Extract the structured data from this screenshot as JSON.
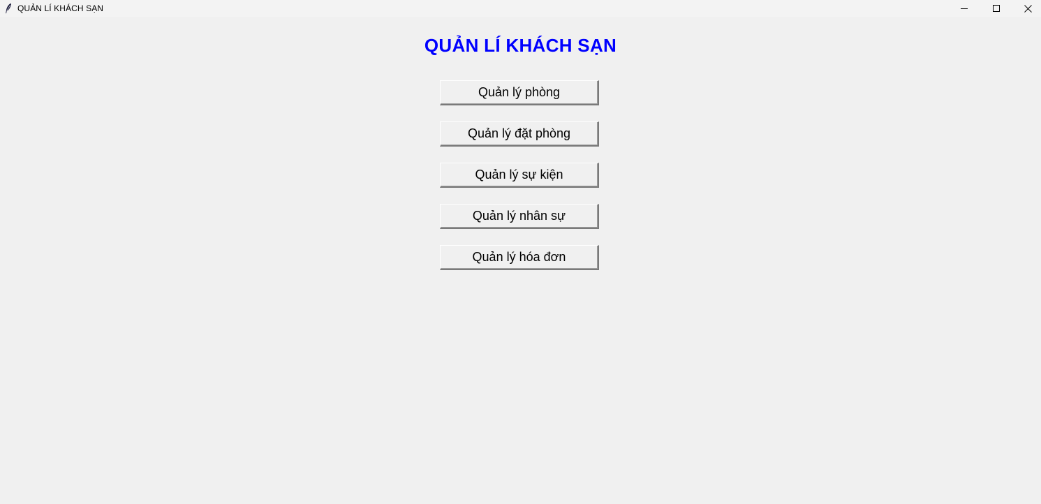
{
  "window": {
    "title": "QUẢN LÍ KHÁCH SẠN",
    "app_icon": "feather-icon",
    "controls": [
      "minimize-icon",
      "maximize-icon",
      "close-icon"
    ]
  },
  "main": {
    "heading": "QUẢN LÍ KHÁCH SẠN",
    "heading_color": "#0000ff",
    "buttons": [
      {
        "label": "Quản lý phòng"
      },
      {
        "label": "Quản lý đặt phòng"
      },
      {
        "label": "Quản lý sự kiện"
      },
      {
        "label": "Quản lý nhân sự"
      },
      {
        "label": "Quản lý hóa đơn"
      }
    ]
  }
}
